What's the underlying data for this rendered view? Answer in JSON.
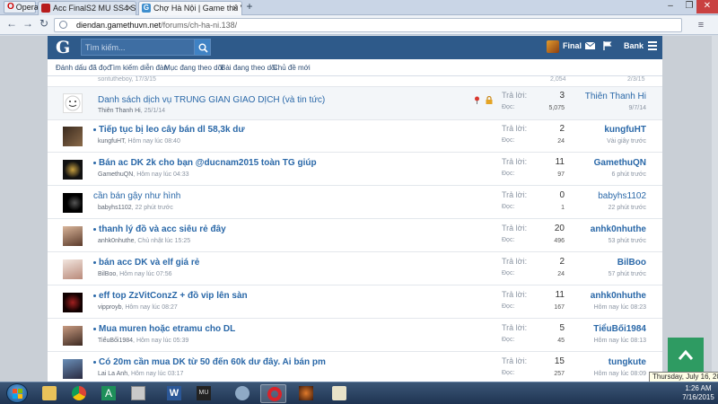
{
  "browser": {
    "menu_label": "Opera",
    "tabs": [
      {
        "label": "Acc FinalS2 MU SS4 SS6 1",
        "active": false
      },
      {
        "label": "Chợ Hà Nội | Game thủ Vi",
        "active": true
      }
    ],
    "url_host": "diendan.gamethuvn.net",
    "url_path": "/forums/ch-ha-ni.138/"
  },
  "header": {
    "logo_letter": "G",
    "search_placeholder": "Tìm kiếm...",
    "user_name": "Final",
    "bank_label": "Bank"
  },
  "subnav": {
    "items": [
      "Đánh dấu đã đọc",
      "Tìm kiếm diễn đàn",
      "Mục đang theo dõi",
      "Bài đang theo dõi",
      "Chủ đề mới"
    ]
  },
  "partial_row": {
    "starter": "sontutheboy, 17/3/15",
    "views": "2,054",
    "last": "2/3/15"
  },
  "labels": {
    "replies": "Trả lời:",
    "views": "Đọc:"
  },
  "threads": [
    {
      "title": "Danh sách dịch vụ TRUNG GIAN GIAO DỊCH (và tin tức)",
      "starter": "Thiên Thanh Hi",
      "date": "25/1/14",
      "replies": "3",
      "views": "5,075",
      "last_user": "Thiên Thanh Hi",
      "last_time": "9/7/14",
      "sticky": true,
      "bold": false
    },
    {
      "title": "Tiếp tục bị leo cây bán dl 58,3k dư",
      "starter": "kungfuHT",
      "date": "Hôm nay lúc 08:40",
      "replies": "2",
      "views": "24",
      "last_user": "kungfuHT",
      "last_time": "Vài giây trước",
      "sticky": false,
      "bold": true
    },
    {
      "title": "Bán ac DK 2k cho bạn @ducnam2015 toàn TG giúp",
      "starter": "GamethuQN",
      "date": "Hôm nay lúc 04:33",
      "replies": "11",
      "views": "97",
      "last_user": "GamethuQN",
      "last_time": "6 phút trước",
      "sticky": false,
      "bold": true
    },
    {
      "title": "cần bán gậy như hình",
      "starter": "babyhs1102",
      "date": "22 phút trước",
      "replies": "0",
      "views": "1",
      "last_user": "babyhs1102",
      "last_time": "22 phút trước",
      "sticky": false,
      "bold": false
    },
    {
      "title": "thanh lý đồ và acc siêu rẻ đây",
      "starter": "anhk0nhuthe",
      "date": "Chủ nhật lúc 15:25",
      "replies": "20",
      "views": "496",
      "last_user": "anhk0nhuthe",
      "last_time": "53 phút trước",
      "sticky": false,
      "bold": true
    },
    {
      "title": "bán acc DK và elf giá rẻ",
      "starter": "BilBoo",
      "date": "Hôm nay lúc 07:56",
      "replies": "2",
      "views": "24",
      "last_user": "BilBoo",
      "last_time": "57 phút trước",
      "sticky": false,
      "bold": true
    },
    {
      "title": "eff top ZzVitConzZ + đồ vip lên sàn",
      "starter": "vipproyb",
      "date": "Hôm nay lúc 08:27",
      "replies": "11",
      "views": "167",
      "last_user": "anhk0nhuthe",
      "last_time": "Hôm nay lúc 08:23",
      "sticky": false,
      "bold": true
    },
    {
      "title": "Mua muren hoặc etramu cho DL",
      "starter": "TiểuBối1984",
      "date": "Hôm nay lúc 05:39",
      "replies": "5",
      "views": "45",
      "last_user": "TiểuBối1984",
      "last_time": "Hôm nay lúc 08:13",
      "sticky": false,
      "bold": true
    },
    {
      "title": "Có 20m cần mua DK từ 50 đến 60k dư đây. Ai bán pm",
      "starter": "Lai La Anh",
      "date": "Hôm nay lúc 03:17",
      "replies": "15",
      "views": "257",
      "last_user": "tungkute",
      "last_time": "Hôm nay lúc 08:09",
      "sticky": false,
      "bold": true
    }
  ],
  "taskbar": {
    "tooltip": "Thursday, July 16, 2015",
    "time": "1:26 AM",
    "date": "7/16/2015"
  },
  "colors": {
    "header_bg": "#2e5a8a",
    "link": "#2a68a8",
    "scroll_top": "#2e9b62"
  }
}
